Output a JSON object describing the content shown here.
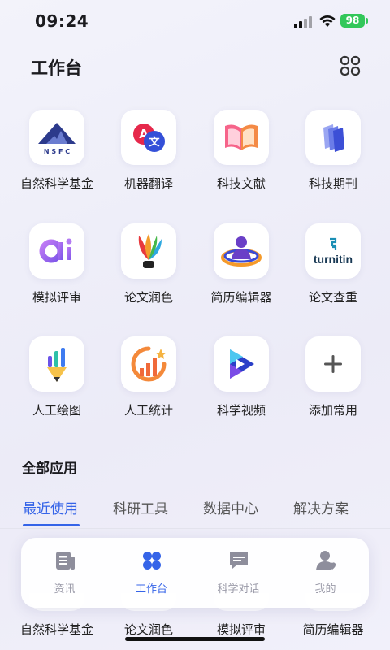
{
  "status_bar": {
    "time": "09:24",
    "battery": "98"
  },
  "header": {
    "title": "工作台"
  },
  "apps": [
    {
      "label": "自然科学基金",
      "icon": "nsfc-logo-icon"
    },
    {
      "label": "机器翻译",
      "icon": "translate-icon"
    },
    {
      "label": "科技文献",
      "icon": "open-book-icon"
    },
    {
      "label": "科技期刊",
      "icon": "journal-stack-icon"
    },
    {
      "label": "模拟评审",
      "icon": "ai-logo-icon"
    },
    {
      "label": "论文润色",
      "icon": "quill-pen-icon"
    },
    {
      "label": "简历编辑器",
      "icon": "resume-person-icon"
    },
    {
      "label": "论文查重",
      "icon": "turnitin-logo-icon",
      "logo_text": "turnitin"
    },
    {
      "label": "人工绘图",
      "icon": "chart-pencil-icon"
    },
    {
      "label": "人工统计",
      "icon": "stats-runner-icon"
    },
    {
      "label": "科学视频",
      "icon": "video-play-icon"
    },
    {
      "label": "添加常用",
      "icon": "plus-icon"
    }
  ],
  "all_apps": {
    "title": "全部应用",
    "tabs": [
      {
        "label": "最近使用",
        "active": true
      },
      {
        "label": "科研工具",
        "active": false
      },
      {
        "label": "数据中心",
        "active": false
      },
      {
        "label": "解决方案",
        "active": false
      }
    ],
    "peek_items": [
      "自然科学基金",
      "论文润色",
      "模拟评审",
      "简历编辑器"
    ]
  },
  "bottom_nav": [
    {
      "label": "资讯",
      "icon": "news-icon",
      "active": false
    },
    {
      "label": "工作台",
      "icon": "workbench-icon",
      "active": true
    },
    {
      "label": "科学对话",
      "icon": "chat-icon",
      "active": false
    },
    {
      "label": "我的",
      "icon": "profile-icon",
      "active": false
    }
  ],
  "colors": {
    "accent": "#3564e8",
    "battery": "#32c75a",
    "inactive": "#9a9aa8"
  }
}
